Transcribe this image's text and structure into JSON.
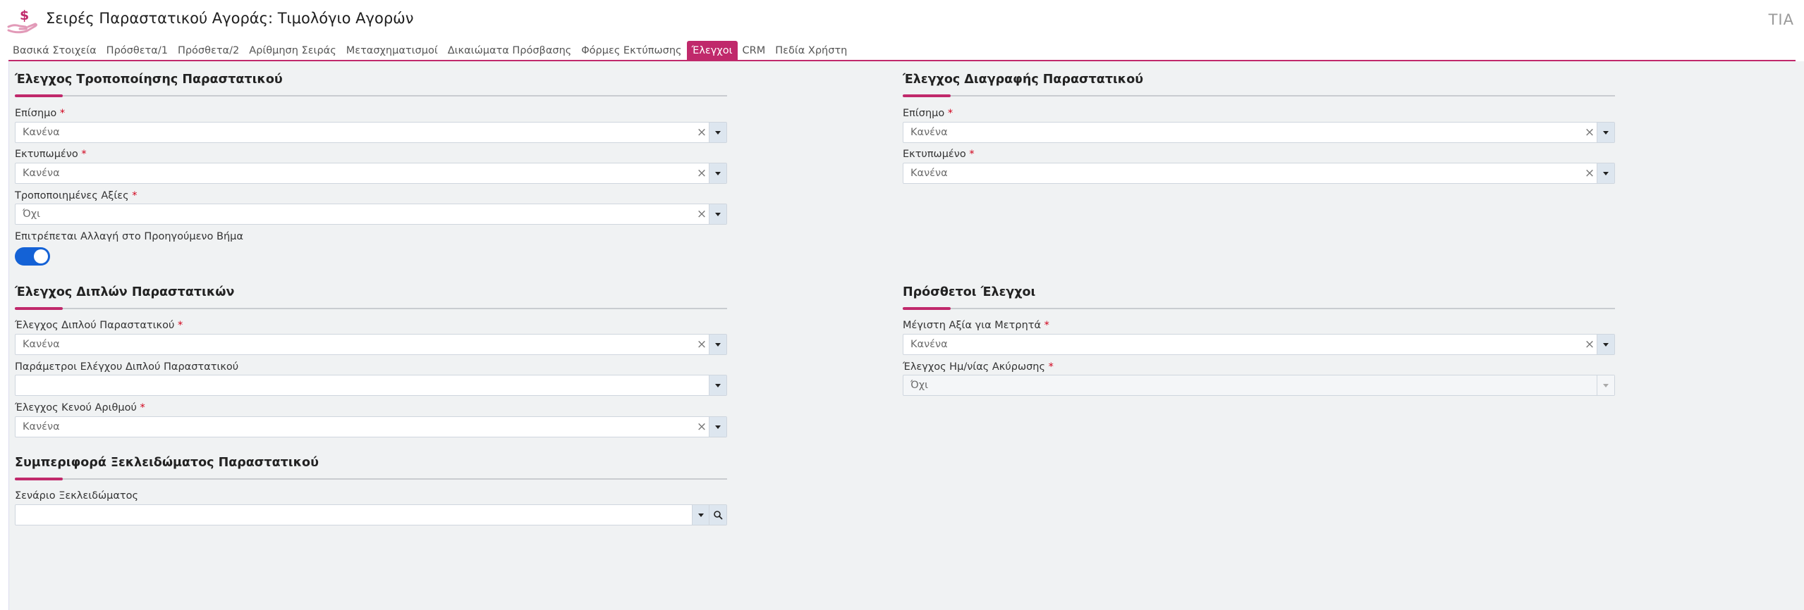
{
  "header": {
    "title": "Σειρές Παραστατικού Αγοράς: Τιμολόγιο Αγορών",
    "user_badge": "TIA"
  },
  "tabs": [
    {
      "label": "Βασικά Στοιχεία",
      "active": false
    },
    {
      "label": "Πρόσθετα/1",
      "active": false
    },
    {
      "label": "Πρόσθετα/2",
      "active": false
    },
    {
      "label": "Αρίθμηση Σειράς",
      "active": false
    },
    {
      "label": "Μετασχηματισμοί",
      "active": false
    },
    {
      "label": "Δικαιώματα Πρόσβασης",
      "active": false
    },
    {
      "label": "Φόρμες Εκτύπωσης",
      "active": false
    },
    {
      "label": "Έλεγχοι",
      "active": true
    },
    {
      "label": "CRM",
      "active": false
    },
    {
      "label": "Πεδία Χρήστη",
      "active": false
    }
  ],
  "sections": {
    "modify": {
      "title": "Έλεγχος Τροποποίησης Παραστατικού",
      "fields": [
        {
          "label": "Επίσημο",
          "required": true,
          "value": "Κανένα"
        },
        {
          "label": "Εκτυπωμένο",
          "required": true,
          "value": "Κανένα"
        },
        {
          "label": "Τροποποιημένες Αξίες",
          "required": true,
          "value": "Όχι"
        }
      ],
      "toggle": {
        "label": "Επιτρέπεται Αλλαγή στο Προηγούμενο Βήμα",
        "on": true
      }
    },
    "delete": {
      "title": "Έλεγχος Διαγραφής Παραστατικού",
      "fields": [
        {
          "label": "Επίσημο",
          "required": true,
          "value": "Κανένα"
        },
        {
          "label": "Εκτυπωμένο",
          "required": true,
          "value": "Κανένα"
        }
      ]
    },
    "duplicates": {
      "title": "Έλεγχος Διπλών Παραστατικών",
      "fields": [
        {
          "label": "Έλεγχος Διπλού Παραστατικού",
          "required": true,
          "value": "Κανένα"
        },
        {
          "label": "Παράμετροι Ελέγχου Διπλού Παραστατικού",
          "required": false,
          "value": ""
        },
        {
          "label": "Έλεγχος Κενού Αριθμού",
          "required": true,
          "value": "Κανένα"
        }
      ]
    },
    "extra": {
      "title": "Πρόσθετοι Έλεγχοι",
      "fields": [
        {
          "label": "Μέγιστη Αξία για Μετρητά",
          "required": true,
          "value": "Κανένα"
        },
        {
          "label": "Έλεγχος Ημ/νίας Ακύρωσης",
          "required": true,
          "value": "Όχι"
        }
      ]
    },
    "unlock": {
      "title": "Συμπεριφορά Ξεκλειδώματος Παραστατικού",
      "fields": [
        {
          "label": "Σενάριο Ξεκλειδώματος",
          "required": false,
          "value": ""
        }
      ]
    }
  },
  "required_mark": "*",
  "colors": {
    "accent": "#c0296b",
    "toggle_on": "#1462d6",
    "required": "#d0021b"
  }
}
